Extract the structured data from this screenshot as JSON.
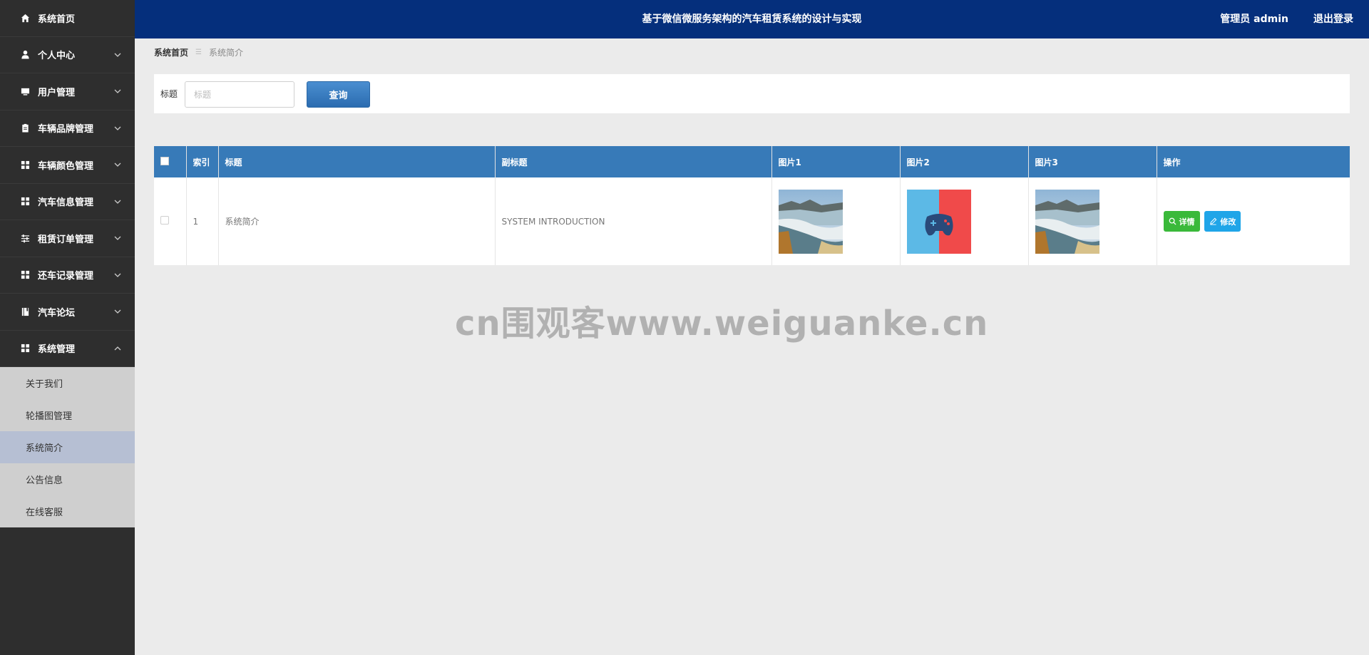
{
  "header": {
    "title": "基于微信微服务架构的汽车租赁系统的设计与实现",
    "user_label": "管理员 admin",
    "logout_label": "退出登录"
  },
  "sidebar": {
    "items": [
      {
        "label": "系统首页",
        "icon": "home-icon"
      },
      {
        "label": "个人中心",
        "icon": "user-icon"
      },
      {
        "label": "用户管理",
        "icon": "monitor-icon"
      },
      {
        "label": "车辆品牌管理",
        "icon": "clipboard-icon"
      },
      {
        "label": "车辆颜色管理",
        "icon": "grid-icon"
      },
      {
        "label": "汽车信息管理",
        "icon": "grid-icon"
      },
      {
        "label": "租赁订单管理",
        "icon": "sliders-icon"
      },
      {
        "label": "还车记录管理",
        "icon": "grid-icon"
      },
      {
        "label": "汽车论坛",
        "icon": "book-icon"
      },
      {
        "label": "系统管理",
        "icon": "grid-icon"
      }
    ],
    "submenu": [
      {
        "label": "关于我们"
      },
      {
        "label": "轮播图管理"
      },
      {
        "label": "系统简介"
      },
      {
        "label": "公告信息"
      },
      {
        "label": "在线客服"
      }
    ]
  },
  "breadcrumb": {
    "home": "系统首页",
    "current": "系统简介"
  },
  "search": {
    "label": "标题",
    "placeholder": "标题",
    "button": "查询"
  },
  "table": {
    "columns": [
      "索引",
      "标题",
      "副标题",
      "图片1",
      "图片2",
      "图片3",
      "操作"
    ],
    "rows": [
      {
        "index": "1",
        "title": "系统简介",
        "subtitle": "SYSTEM INTRODUCTION",
        "detail_label": "详情",
        "edit_label": "修改"
      }
    ]
  },
  "watermark": "cn围观客www.weiguanke.cn",
  "colors": {
    "header_bg": "#052f7c",
    "sidebar_bg": "#2e2e2e",
    "table_header_bg": "#377ab8",
    "detail_btn": "#3ab93a",
    "edit_btn": "#1fa5e8"
  }
}
